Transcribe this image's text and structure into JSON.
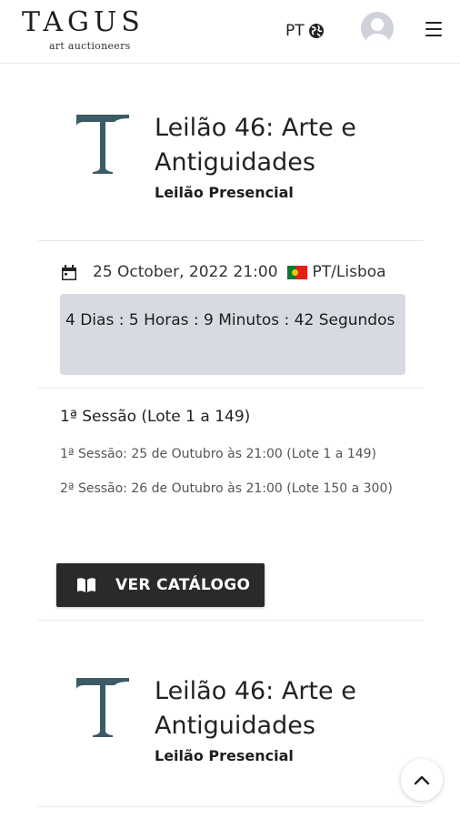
{
  "header": {
    "logo_word": "TAGUS",
    "logo_sub": "art auctioneers",
    "lang_label": "PT",
    "icons": [
      "globe-icon",
      "user-avatar-icon",
      "hamburger-menu-icon"
    ]
  },
  "auctions": [
    {
      "logo_letter": "T",
      "title": "Leilão 46: Arte e Antiguidades",
      "type": "Leilão Presencial",
      "date": "25 October, 2022 21:00",
      "location": "PT/Lisboa",
      "countdown": "4 Dias : 5 Horas : 9 Minutos : 42 Segundos",
      "session_title": "1ª Sessão (Lote 1 a 149)",
      "sessions": [
        "1ª Sessão: 25 de Outubro às 21:00 (Lote 1 a 149)",
        "2ª Sessão: 26 de Outubro às 21:00 (Lote 150 a 300)"
      ],
      "catalog_button": "VER CATÁLOGO"
    },
    {
      "logo_letter": "T",
      "title": "Leilão 46: Arte e Antiguidades",
      "type": "Leilão Presencial"
    }
  ],
  "colors": {
    "logo_mark": "#3b5b66",
    "countdown_bg": "#d8dae1",
    "button_bg": "#2a2a2a"
  }
}
